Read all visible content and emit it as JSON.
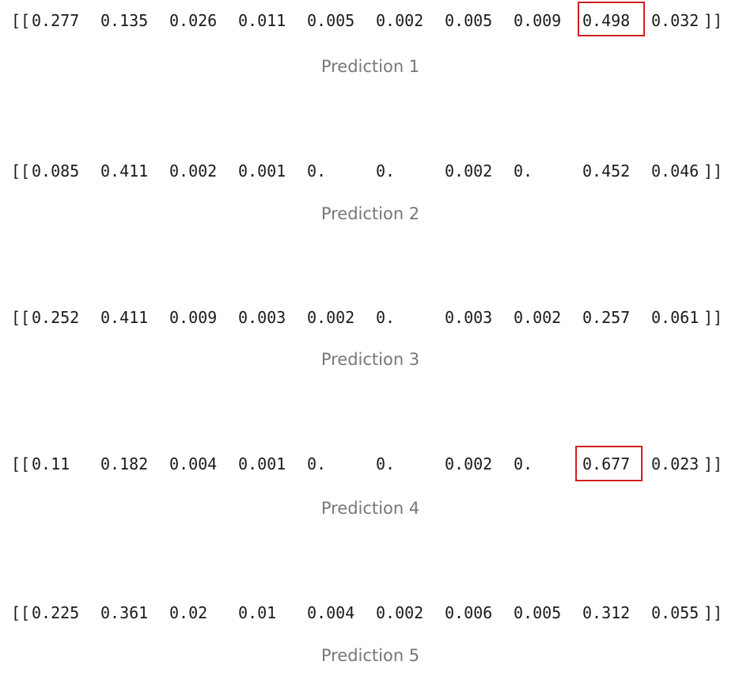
{
  "predictions": [
    {
      "caption": "Prediction 1",
      "open": "[[",
      "close": "]]",
      "values": [
        "0.277",
        "0.135",
        "0.026",
        "0.011",
        "0.005",
        "0.002",
        "0.005",
        "0.009",
        "0.498",
        "0.032"
      ],
      "highlighted_index": 8
    },
    {
      "caption": "Prediction 2",
      "open": "[[",
      "close": "]]",
      "values": [
        "0.085",
        "0.411",
        "0.002",
        "0.001",
        "0.",
        "0.",
        "0.002",
        "0.",
        "0.452",
        "0.046"
      ],
      "highlighted_index": null
    },
    {
      "caption": "Prediction 3",
      "open": "[[",
      "close": "]]",
      "values": [
        "0.252",
        "0.411",
        "0.009",
        "0.003",
        "0.002",
        "0.",
        "0.003",
        "0.002",
        "0.257",
        "0.061"
      ],
      "highlighted_index": null
    },
    {
      "caption": "Prediction 4",
      "open": "[[",
      "close": "]]",
      "values": [
        "0.11",
        "0.182",
        "0.004",
        "0.001",
        "0.",
        "0.",
        "0.002",
        "0.",
        "0.677",
        "0.023"
      ],
      "highlighted_index": 8
    },
    {
      "caption": "Prediction 5",
      "open": "[[",
      "close": "]]",
      "values": [
        "0.225",
        "0.361",
        "0.02",
        "0.01",
        "0.004",
        "0.002",
        "0.006",
        "0.005",
        "0.312",
        "0.055"
      ],
      "highlighted_index": null
    }
  ],
  "colors": {
    "text": "#1a1a1a",
    "caption": "#777777",
    "highlight_border": "#d01f1f"
  }
}
